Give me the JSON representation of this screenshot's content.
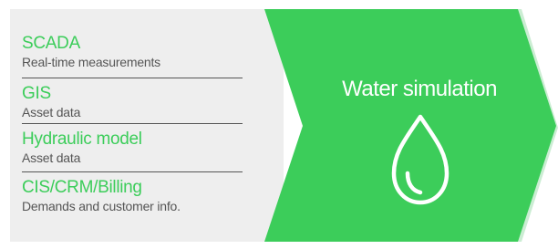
{
  "colors": {
    "accent": "#3ccd5a",
    "accent_shadow": "#29a643",
    "panel": "#eeeeee",
    "text_muted": "#555555"
  },
  "sources": [
    {
      "title": "SCADA",
      "desc": "Real-time measurements"
    },
    {
      "title": "GIS",
      "desc": "Asset data"
    },
    {
      "title": "Hydraulic model",
      "desc": "Asset data"
    },
    {
      "title": "CIS/CRM/Billing",
      "desc": "Demands and customer info."
    }
  ],
  "target": {
    "label": "Water simulation",
    "icon": "water-drop-icon"
  }
}
